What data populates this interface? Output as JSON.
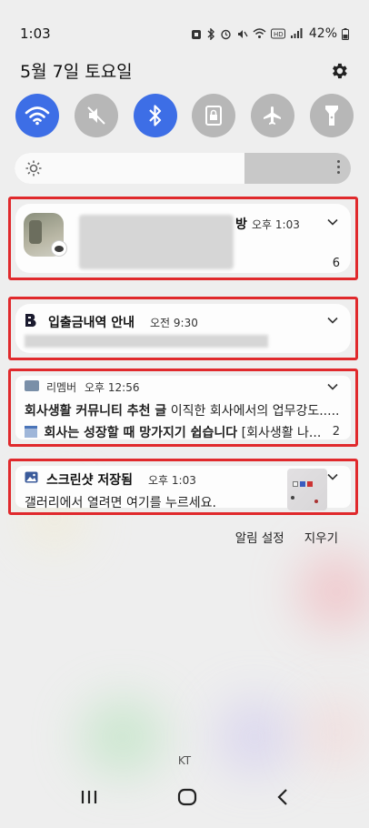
{
  "status_bar": {
    "time": "1:03",
    "battery": "42%"
  },
  "header": {
    "date": "5월 7일 토요일"
  },
  "quick_toggles": [
    {
      "name": "wifi-icon",
      "state": "on"
    },
    {
      "name": "mute-icon",
      "state": "off"
    },
    {
      "name": "bluetooth-icon",
      "state": "on"
    },
    {
      "name": "rotation-lock-icon",
      "state": "off"
    },
    {
      "name": "airplane-icon",
      "state": "off"
    },
    {
      "name": "flashlight-icon",
      "state": "off"
    }
  ],
  "brightness": {
    "level_percent": 68
  },
  "notifications": {
    "chat": {
      "title_tail": "방",
      "time": "오후 1:03",
      "count": "6"
    },
    "bank": {
      "title": "입출금내역 안내",
      "time": "오전 9:30"
    },
    "remember": {
      "app": "리멤버",
      "time": "오후 12:56",
      "line1_title": "회사생활 커뮤니티 추천 글",
      "line1_text": "이직한 회사에서의 업무강도.....",
      "line2_title": "회사는 성장할 때 망가지기 쉽습니다",
      "line2_text": "[회사생활 나...",
      "count": "2"
    },
    "screenshot": {
      "title": "스크린샷 저장됨",
      "time": "오후 1:03",
      "text": "갤러리에서 열려면 여기를 누르세요."
    }
  },
  "actions": {
    "settings": "알림 설정",
    "clear": "지우기"
  },
  "carrier": "KT",
  "colors": {
    "accent": "#3d6ee6",
    "highlight": "#e0292c"
  }
}
